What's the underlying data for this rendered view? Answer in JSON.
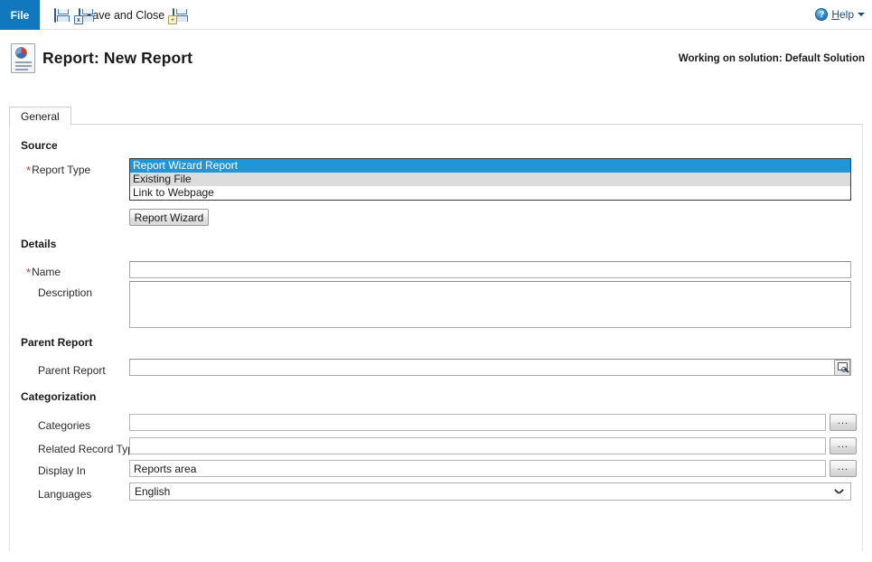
{
  "ribbon": {
    "file_tab": "File",
    "commands": [
      {
        "name": "save",
        "label": "",
        "icon": "save-floppy-icon"
      },
      {
        "name": "save-and-close",
        "label": "Save and Close",
        "icon": "save-and-close-icon"
      },
      {
        "name": "save-and-new",
        "label": "",
        "icon": "save-and-new-icon"
      }
    ],
    "help": {
      "label_prefix": "H",
      "label_rest": "elp",
      "icon": "help-question-icon"
    }
  },
  "header": {
    "icon": "report-document-icon",
    "title": "Report: New Report",
    "solution_note": "Working on solution: Default Solution"
  },
  "tabs": [
    {
      "label": "General",
      "active": true
    }
  ],
  "sections": {
    "source": {
      "heading": "Source",
      "report_type": {
        "label": "Report Type",
        "required": true,
        "options": [
          {
            "label": "Report Wizard Report",
            "selected": true
          },
          {
            "label": "Existing File",
            "selected": false
          },
          {
            "label": "Link to Webpage",
            "selected": false
          }
        ]
      },
      "wizard_button": "Report Wizard"
    },
    "details": {
      "heading": "Details",
      "name": {
        "label": "Name",
        "required": true,
        "value": "",
        "placeholder": ""
      },
      "description": {
        "label": "Description",
        "required": false,
        "value": "",
        "placeholder": ""
      }
    },
    "parent_report": {
      "heading": "Parent Report",
      "field": {
        "label": "Parent Report",
        "value": "",
        "placeholder": "",
        "lookup_icon": "lookup-magnifier-icon"
      }
    },
    "categorization": {
      "heading": "Categorization",
      "categories": {
        "label": "Categories",
        "value": "",
        "button": "..."
      },
      "related_record_types": {
        "label": "Related Record Types",
        "value": "",
        "button": "..."
      },
      "display_in": {
        "label": "Display In",
        "value": "Reports area",
        "button": "..."
      },
      "languages": {
        "label": "Languages",
        "value": "English",
        "chevron_icon": "chevron-down-icon"
      }
    }
  },
  "colors": {
    "file_tab_blue": "#1278be",
    "selection_blue": "#2196d6",
    "required_red": "#c8352b",
    "help_link": "#1a4f82"
  }
}
